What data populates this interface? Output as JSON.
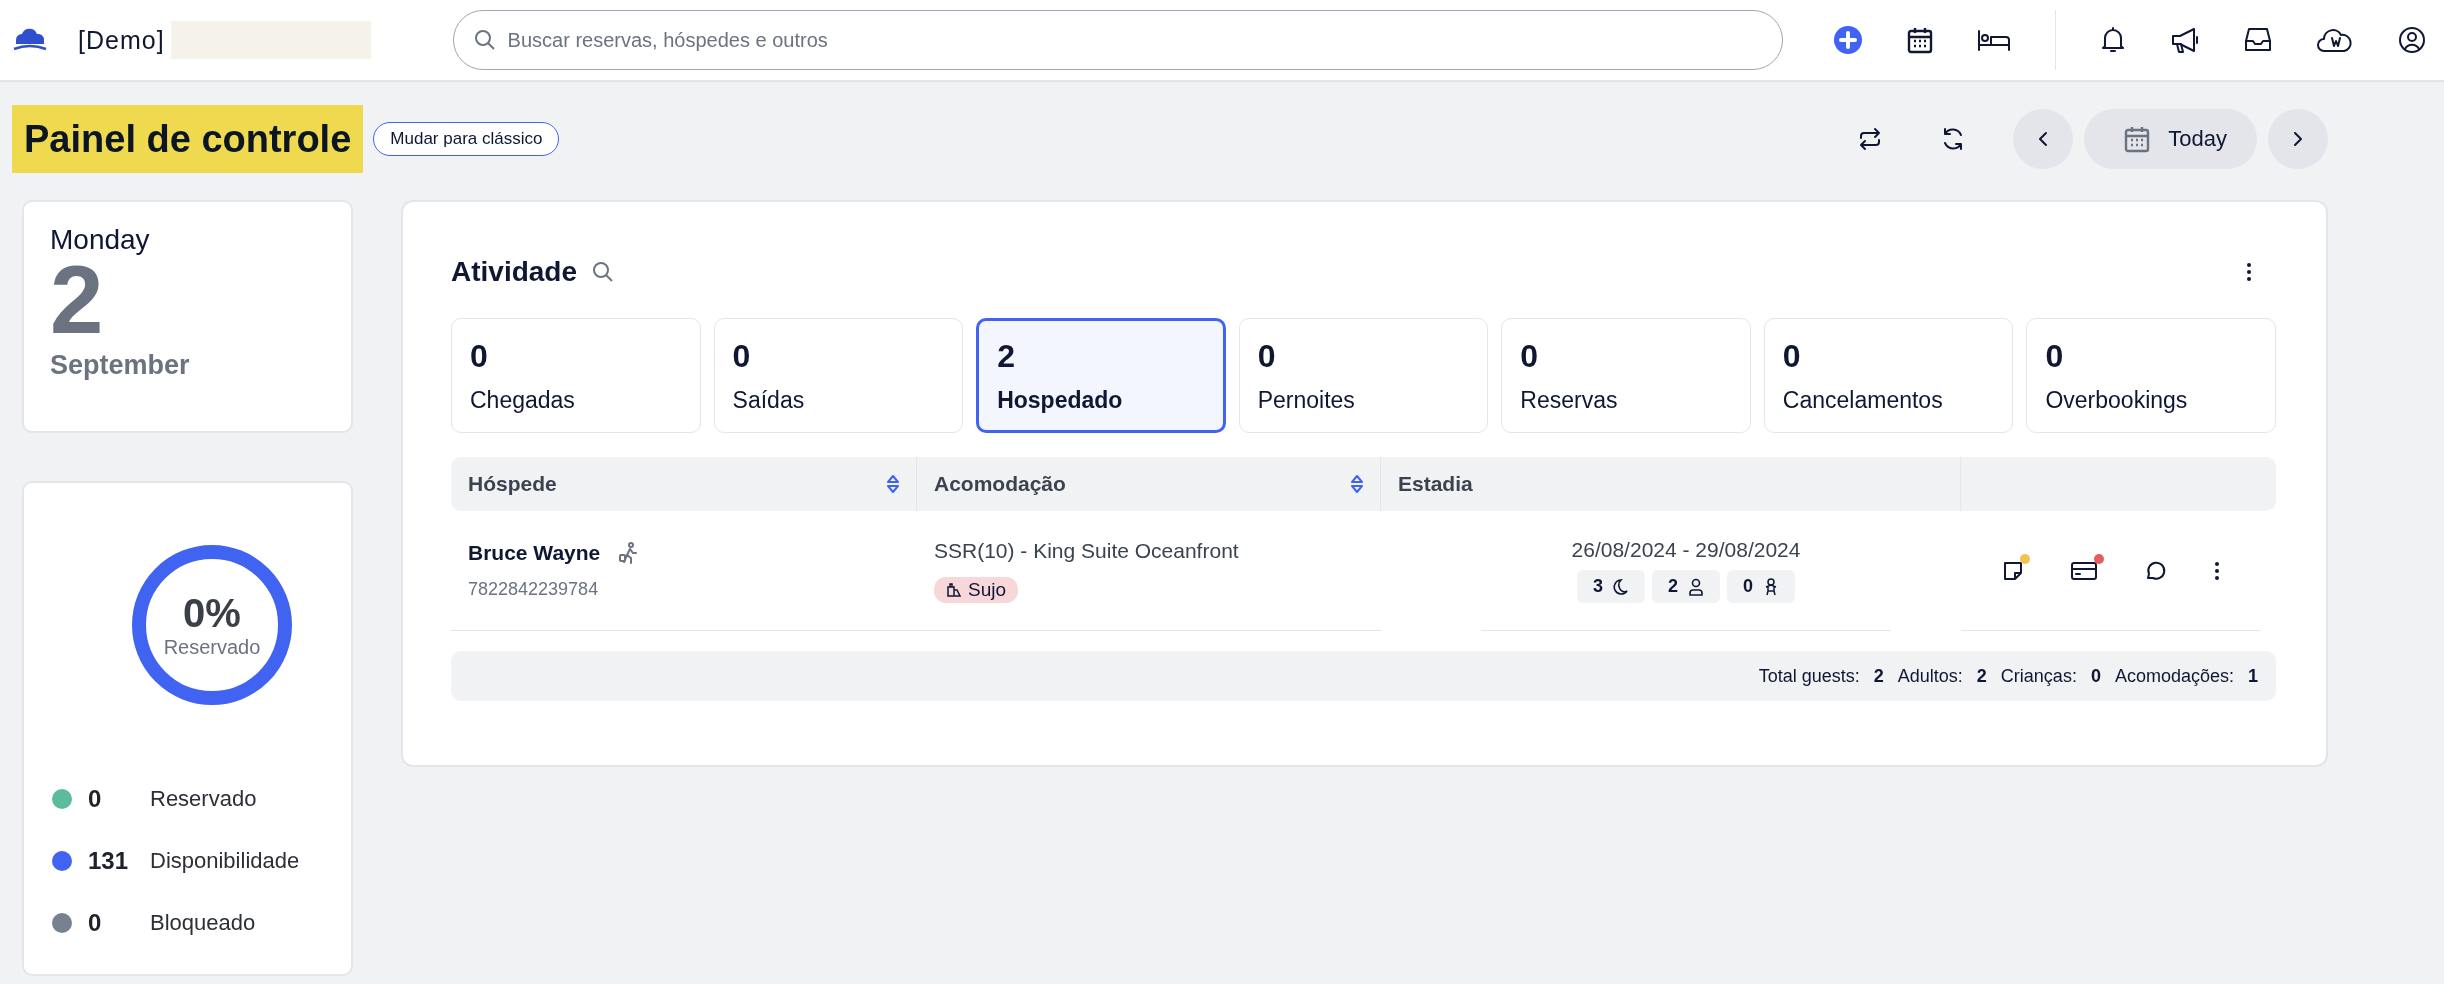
{
  "topbar": {
    "brand": "[Demo]",
    "search": {
      "placeholder": "Buscar reservas, hóspedes e outros"
    }
  },
  "header": {
    "title": "Painel de controle",
    "switch_button": "Mudar para clássico",
    "today_button": "Today"
  },
  "date_card": {
    "weekday": "Monday",
    "day": "2",
    "month": "September"
  },
  "occupancy": {
    "percent": "0%",
    "caption": "Reservado",
    "legend": [
      {
        "value": "0",
        "label": "Reservado",
        "color": "#5dbb9d"
      },
      {
        "value": "131",
        "label": "Disponibilidade",
        "color": "#4163f2"
      },
      {
        "value": "0",
        "label": "Bloqueado",
        "color": "#78818f"
      }
    ]
  },
  "activity": {
    "title": "Atividade",
    "tiles": [
      {
        "count": "0",
        "label": "Chegadas",
        "selected": false
      },
      {
        "count": "0",
        "label": "Saídas",
        "selected": false
      },
      {
        "count": "2",
        "label": "Hospedado",
        "selected": true
      },
      {
        "count": "0",
        "label": "Pernoites",
        "selected": false
      },
      {
        "count": "0",
        "label": "Reservas",
        "selected": false
      },
      {
        "count": "0",
        "label": "Cancelamentos",
        "selected": false
      },
      {
        "count": "0",
        "label": "Overbookings",
        "selected": false
      }
    ],
    "table": {
      "columns": [
        {
          "label": "Hóspede",
          "sortable": true
        },
        {
          "label": "Acomodação",
          "sortable": true
        },
        {
          "label": "Estadia",
          "sortable": false
        }
      ],
      "rows": [
        {
          "guest": "Bruce Wayne",
          "guest_id": "7822842239784",
          "room": "SSR(10) - King Suite Oceanfront",
          "room_status": "Sujo",
          "dates": "26/08/2024 - 29/08/2024",
          "nights": "3",
          "adults": "2",
          "children": "0",
          "actions": [
            {
              "kind": "note",
              "color": "#f2c14e"
            },
            {
              "kind": "payment",
              "color": "#e35d5d"
            },
            {
              "kind": "chat"
            },
            {
              "kind": "more"
            }
          ]
        }
      ]
    },
    "totals": [
      {
        "label": "Total guests:",
        "value": "2"
      },
      {
        "label": "Adultos:",
        "value": "2"
      },
      {
        "label": "Crianças:",
        "value": "0"
      },
      {
        "label": "Acomodações:",
        "value": "1"
      }
    ]
  }
}
